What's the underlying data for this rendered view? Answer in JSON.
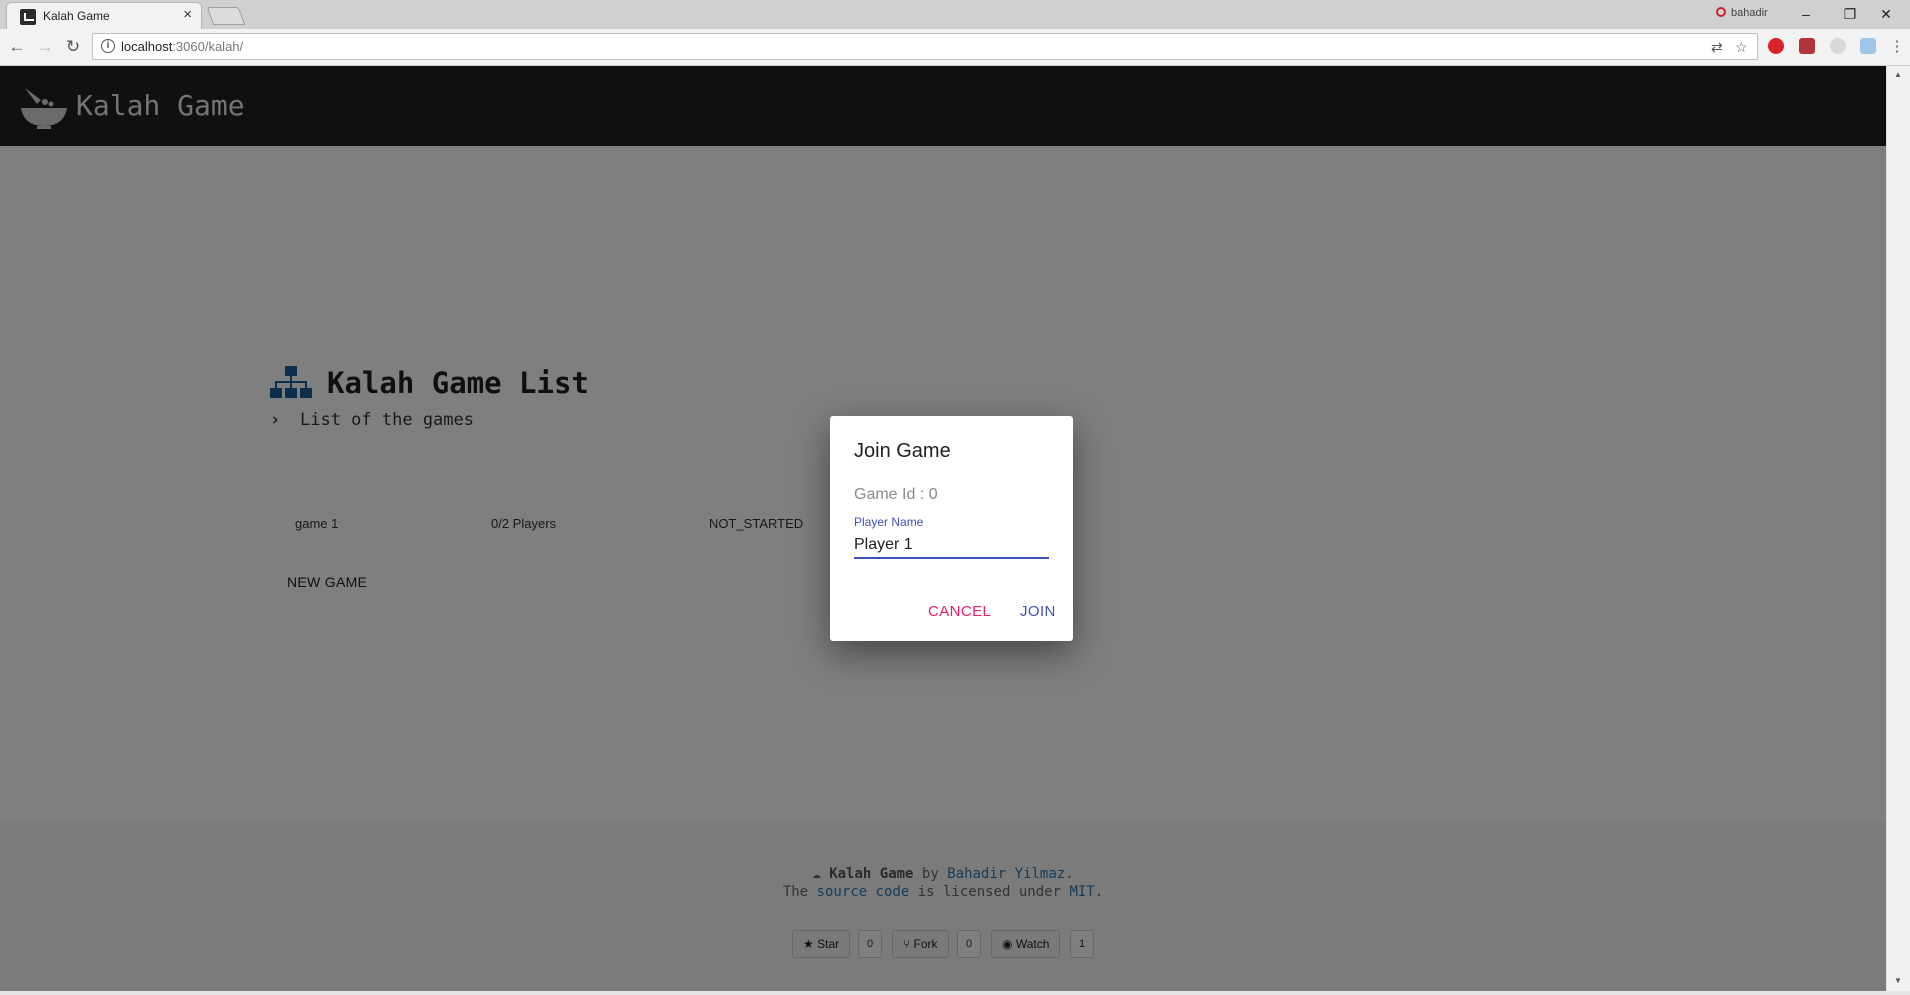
{
  "browser": {
    "tab_title": "Kalah Game",
    "tab_close": "×",
    "url_host": "localhost",
    "url_rest": ":3060/kalah/",
    "profile_name": "bahadir",
    "window_minimize": "–",
    "window_restore": "❐",
    "window_close": "✕"
  },
  "app": {
    "title": "Kalah Game"
  },
  "game_list": {
    "title": "Kalah Game List",
    "subtitle": "List of the games",
    "games": [
      {
        "name": "game 1",
        "players": "0/2 Players",
        "status": "NOT_STARTED"
      }
    ],
    "new_game_label": "NEW GAME"
  },
  "footer": {
    "project": "Kalah Game",
    "by": "by",
    "author": "Bahadir Yilmaz",
    "period": ".",
    "license_prefix": "The",
    "source_link": "source code",
    "license_middle": "is licensed under",
    "license_link": "MIT",
    "github": {
      "star_label": "Star",
      "star_count": "0",
      "fork_label": "Fork",
      "fork_count": "0",
      "watch_label": "Watch",
      "watch_count": "1"
    }
  },
  "dialog": {
    "title": "Join Game",
    "game_id": "Game Id : 0",
    "field_label": "Player Name",
    "field_value": "Player 1",
    "cancel_label": "CANCEL",
    "join_label": "JOIN"
  },
  "colors": {
    "appbar": "#212121",
    "primary": "#3f51b5",
    "accent": "#e91e63",
    "icon_blue": "#1a5e9a",
    "link": "#2a7ab8"
  }
}
